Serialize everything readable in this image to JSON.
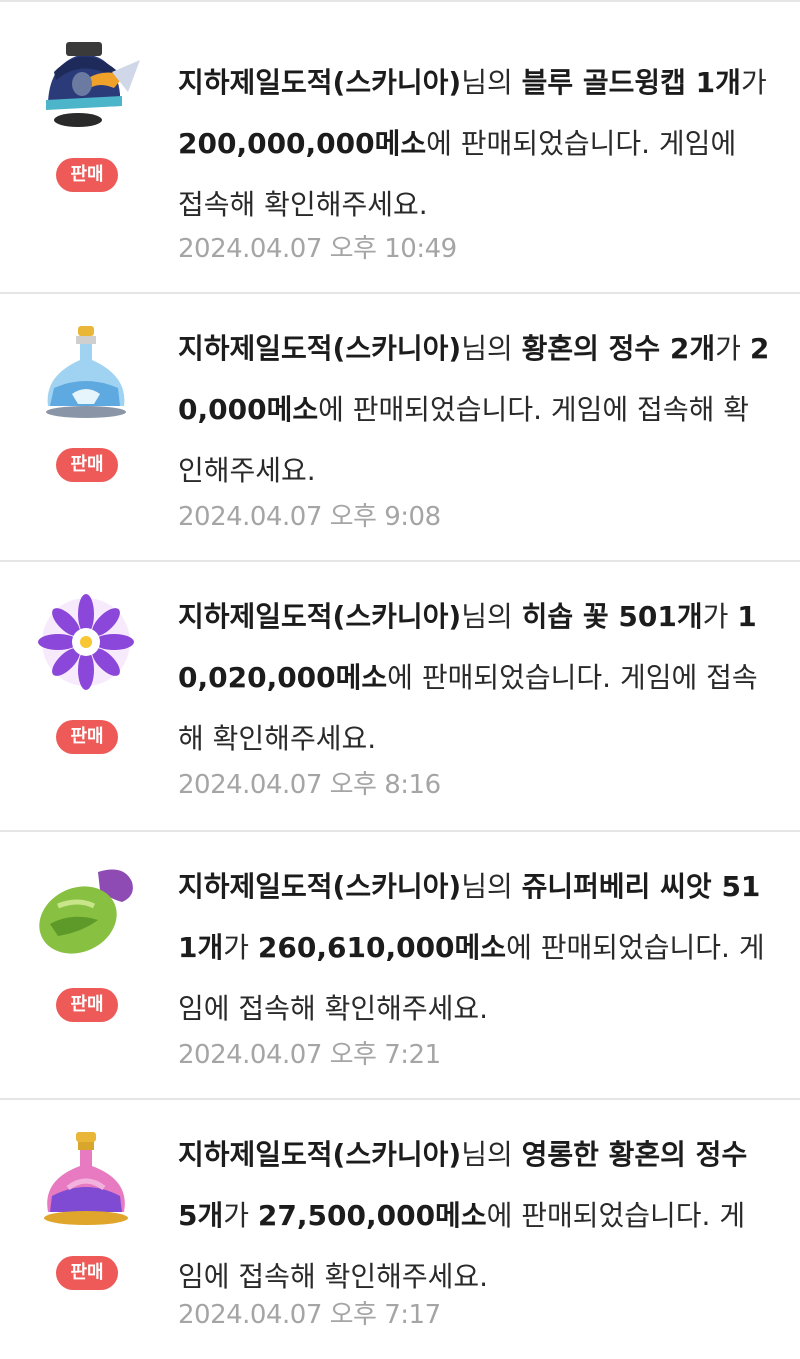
{
  "notifications": [
    {
      "badge": "판매",
      "seller": "지하제일도적(스카니아)",
      "suffix_owner": "님의 ",
      "item_qty": "블루 골드윙캡 1개",
      "particle_subject": "가 ",
      "price": "200,000,000메소",
      "tail": "에 판매되었습니다. 게임에 접속해 확인해주세요.",
      "date": "2024.04.07 오후 10:49",
      "icon": "blue-gold-wing-cap-icon"
    },
    {
      "badge": "판매",
      "seller": "지하제일도적(스카니아)",
      "suffix_owner": "님의 ",
      "item_qty": "황혼의 정수 2개",
      "particle_subject": "가 ",
      "price": "20,000메소",
      "tail": "에 판매되었습니다. 게임에 접속해 확인해주세요.",
      "date": "2024.04.07 오후 9:08",
      "icon": "twilight-essence-potion-icon"
    },
    {
      "badge": "판매",
      "seller": "지하제일도적(스카니아)",
      "suffix_owner": "님의 ",
      "item_qty": "히솝 꽃 501개",
      "particle_subject": "가 ",
      "price": "10,020,000메소",
      "tail": "에 판매되었습니다. 게임에 접속해 확인해주세요.",
      "date": "2024.04.07 오후 8:16",
      "icon": "hyssop-flower-icon"
    },
    {
      "badge": "판매",
      "seller": "지하제일도적(스카니아)",
      "suffix_owner": "님의 ",
      "item_qty": "쥬니퍼베리 씨앗 511개",
      "particle_subject": "가 ",
      "price": "260,610,000메소",
      "tail": "에 판매되었습니다. 게임에 접속해 확인해주세요.",
      "date": "2024.04.07 오후 7:21",
      "icon": "juniper-berry-seed-icon"
    },
    {
      "badge": "판매",
      "seller": "지하제일도적(스카니아)",
      "suffix_owner": "님의 ",
      "item_qty": "영롱한 황혼의 정수 5개",
      "particle_subject": "가 ",
      "price": "27,500,000메소",
      "tail": "에 판매되었습니다. 게임에 접속해 확인해주세요.",
      "date": "2024.04.07 오후 7:17",
      "icon": "radiant-twilight-essence-icon"
    }
  ],
  "colors": {
    "badge": "#ee5a57",
    "text": "#2a2a2a",
    "date": "#a5a5a5",
    "divider": "#e6e6e6"
  }
}
